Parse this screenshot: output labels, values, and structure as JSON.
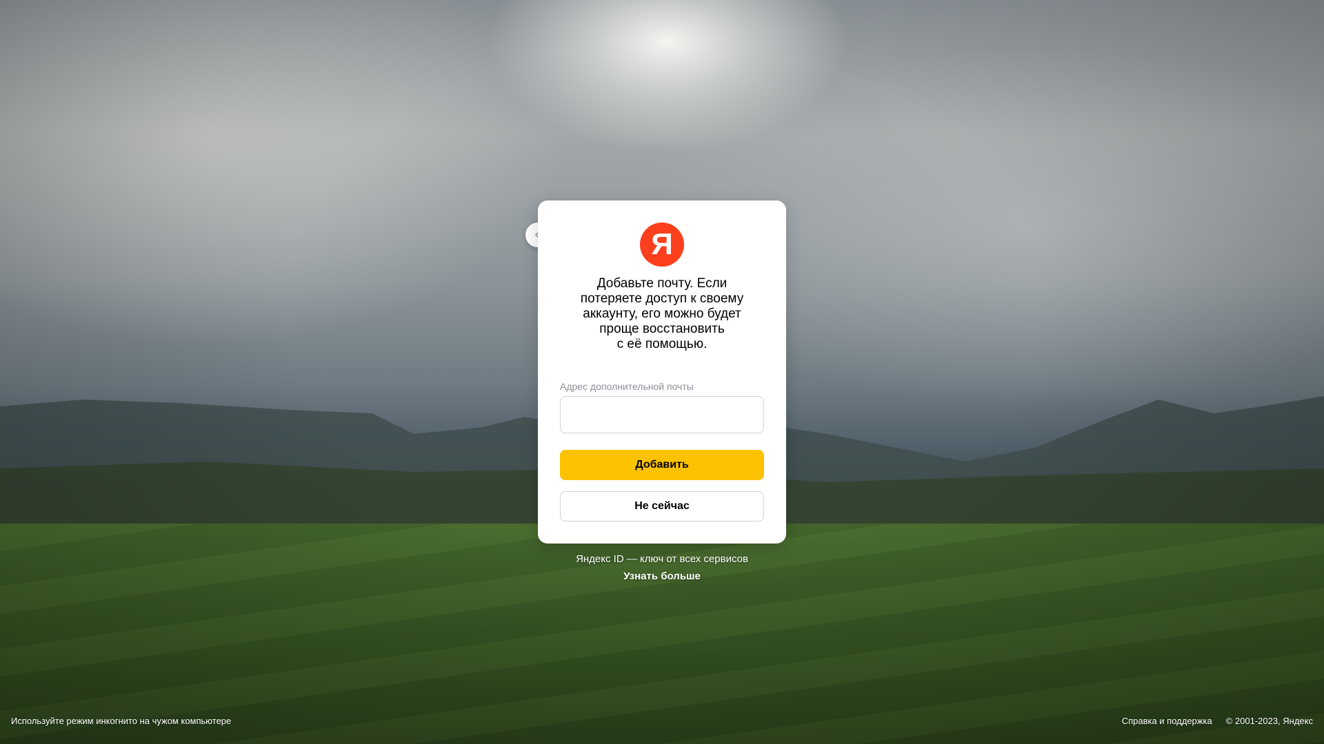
{
  "dialog": {
    "logo_letter": "Я",
    "title": "Добавьте почту. Если\nпотеряете доступ к своему\nаккаунту, его можно будет\nпроще восстановить\nс её помощью.",
    "email_field": {
      "label": "Адрес дополнительной почты",
      "value": "",
      "placeholder": ""
    },
    "primary_button": "Добавить",
    "secondary_button": "Не сейчас"
  },
  "promo": {
    "text": "Яндекс ID — ключ от всех сервисов",
    "link": "Узнать больше"
  },
  "footer": {
    "incognito_hint": "Используйте режим инкогнито на чужом компьютере",
    "help_link": "Справка и поддержка",
    "copyright": "© 2001-2023, Яндекс"
  },
  "colors": {
    "brand_red": "#fc3f1d",
    "accent_yellow": "#fcc200"
  }
}
